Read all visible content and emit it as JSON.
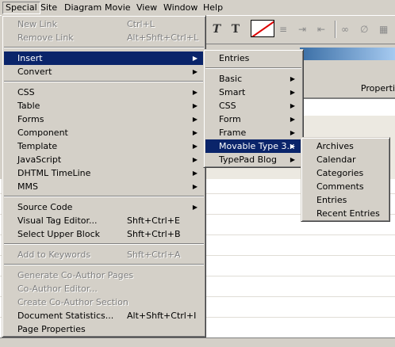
{
  "menubar": [
    "Special",
    "Site",
    "Diagram",
    "Movie",
    "View",
    "Window",
    "Help"
  ],
  "toolbar": {
    "italic_label": "T",
    "code_label": "T"
  },
  "properties_header": "Properti",
  "special_menu": {
    "items": [
      {
        "label": "New Link",
        "shortcut": "Ctrl+L"
      },
      {
        "label": "Remove Link",
        "shortcut": "Alt+Shft+Ctrl+L"
      },
      {
        "label": "Insert"
      },
      {
        "label": "Convert"
      },
      {
        "label": "CSS"
      },
      {
        "label": "Table"
      },
      {
        "label": "Forms"
      },
      {
        "label": "Component"
      },
      {
        "label": "Template"
      },
      {
        "label": "JavaScript"
      },
      {
        "label": "DHTML TimeLine"
      },
      {
        "label": "MMS"
      },
      {
        "label": "Source Code"
      },
      {
        "label": "Visual Tag Editor...",
        "shortcut": "Shft+Ctrl+E"
      },
      {
        "label": "Select Upper Block",
        "shortcut": "Shft+Ctrl+B"
      },
      {
        "label": "Add to Keywords",
        "shortcut": "Shft+Ctrl+A"
      },
      {
        "label": "Generate Co-Author Pages"
      },
      {
        "label": "Co-Author Editor..."
      },
      {
        "label": "Create Co-Author Section"
      },
      {
        "label": "Document Statistics...",
        "shortcut": "Alt+Shft+Ctrl+I"
      },
      {
        "label": "Page Properties"
      }
    ]
  },
  "insert_menu": {
    "items": [
      "Entries",
      "Basic",
      "Smart",
      "CSS",
      "Form",
      "Frame",
      "Movable Type 3.x",
      "TypePad Blog"
    ]
  },
  "movable_type_menu": {
    "items": [
      "Archives",
      "Calendar",
      "Categories",
      "Comments",
      "Entries",
      "Recent Entries"
    ]
  }
}
